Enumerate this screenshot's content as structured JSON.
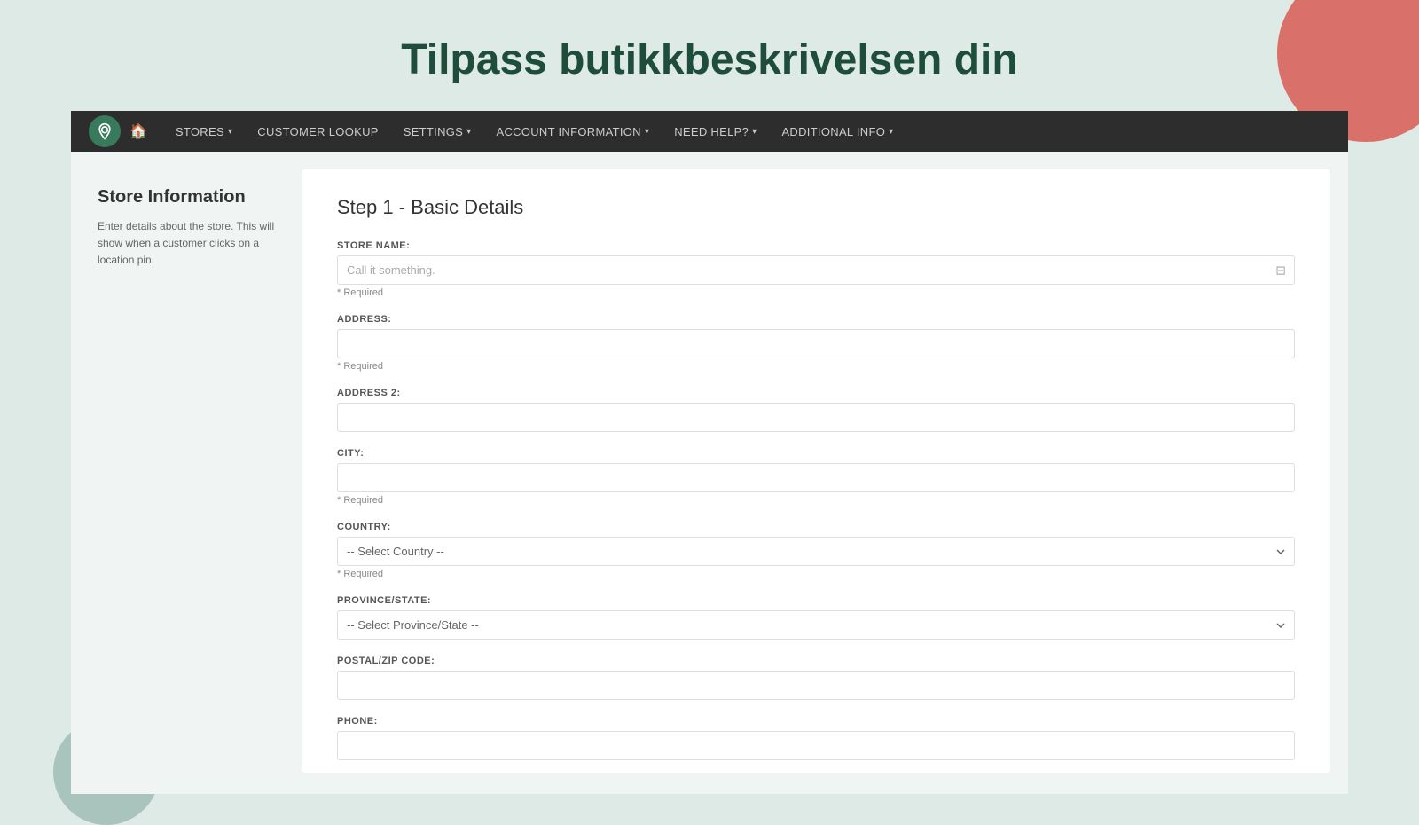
{
  "page": {
    "title": "Tilpass butikkbeskrivelsen din",
    "background_color": "#deeae6"
  },
  "navbar": {
    "home_icon": "🏠",
    "items": [
      {
        "label": "STORES",
        "has_dropdown": true
      },
      {
        "label": "CUSTOMER LOOKUP",
        "has_dropdown": false
      },
      {
        "label": "SETTINGS",
        "has_dropdown": true
      },
      {
        "label": "ACCOUNT INFORMATION",
        "has_dropdown": true
      },
      {
        "label": "NEED HELP?",
        "has_dropdown": true
      },
      {
        "label": "ADDITIONAL INFO",
        "has_dropdown": true
      }
    ]
  },
  "sidebar": {
    "title": "Store Information",
    "description": "Enter details about the store. This will show when a customer clicks on a location pin."
  },
  "form": {
    "step_title": "Step 1 - Basic Details",
    "fields": [
      {
        "id": "store-name",
        "label": "STORE NAME:",
        "type": "text",
        "placeholder": "Call it something.",
        "required": true,
        "has_icon": true
      },
      {
        "id": "address",
        "label": "ADDRESS:",
        "type": "text",
        "placeholder": "",
        "required": true
      },
      {
        "id": "address2",
        "label": "ADDRESS 2:",
        "type": "text",
        "placeholder": "",
        "required": false
      },
      {
        "id": "city",
        "label": "CITY:",
        "type": "text",
        "placeholder": "",
        "required": true
      },
      {
        "id": "country",
        "label": "COUNTRY:",
        "type": "select",
        "placeholder": "-- Select Country --",
        "required": true
      },
      {
        "id": "province",
        "label": "PROVINCE/STATE:",
        "type": "select",
        "placeholder": "-- Select Province/State --",
        "required": false
      },
      {
        "id": "postal",
        "label": "POSTAL/ZIP CODE:",
        "type": "text",
        "placeholder": "",
        "required": false
      },
      {
        "id": "phone",
        "label": "PHONE:",
        "type": "text",
        "placeholder": "",
        "required": false
      }
    ],
    "required_text": "* Required"
  }
}
